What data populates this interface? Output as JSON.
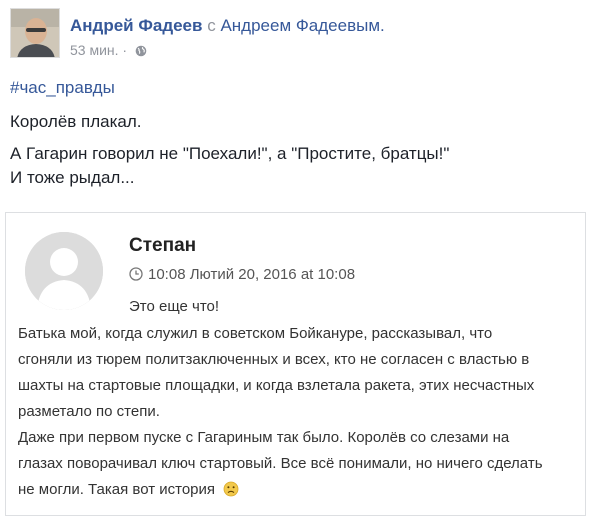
{
  "post": {
    "author": "Андрей Фадеев",
    "with_word": "с",
    "tagged": "Андреем Фадеевым.",
    "time": "53 мин.",
    "separator": "·",
    "privacy_icon": "globe-icon",
    "hashtag": "#час_правды",
    "lines": [
      "Королёв плакал.",
      "А Гагарин говорил не \"Поехали!\", а \"Простите, братцы!\"",
      "И тоже рыдал..."
    ]
  },
  "comment": {
    "name": "Степан",
    "time_icon": "clock-icon",
    "timestamp": "10:08 Лютий 20, 2016 at 10:08",
    "lines": [
      "Это еще что!",
      "Батька мой, когда служил в советском Бойкануре, рассказывал, что",
      "сгоняли из тюрем политзаключенных и всех, кто не согласен с властью в",
      "шахты на стартовые площадки, и когда взлетала ракета, этих несчастных",
      "разметало по степи.",
      "Даже при первом пуске с Гагариным так было. Королёв со слезами на",
      "глазах поворачивал ключ стартовый. Все всё понимали, но ничего сделать",
      "не могли. Такая вот история"
    ],
    "emoji_icon": "sad-face-emoji-icon"
  },
  "colors": {
    "link": "#365899",
    "meta": "#90949c",
    "text": "#1d2129",
    "card_border": "#dddfe2",
    "placeholder_avatar": "#dcdcdc",
    "emoji": "#f2c94c"
  }
}
